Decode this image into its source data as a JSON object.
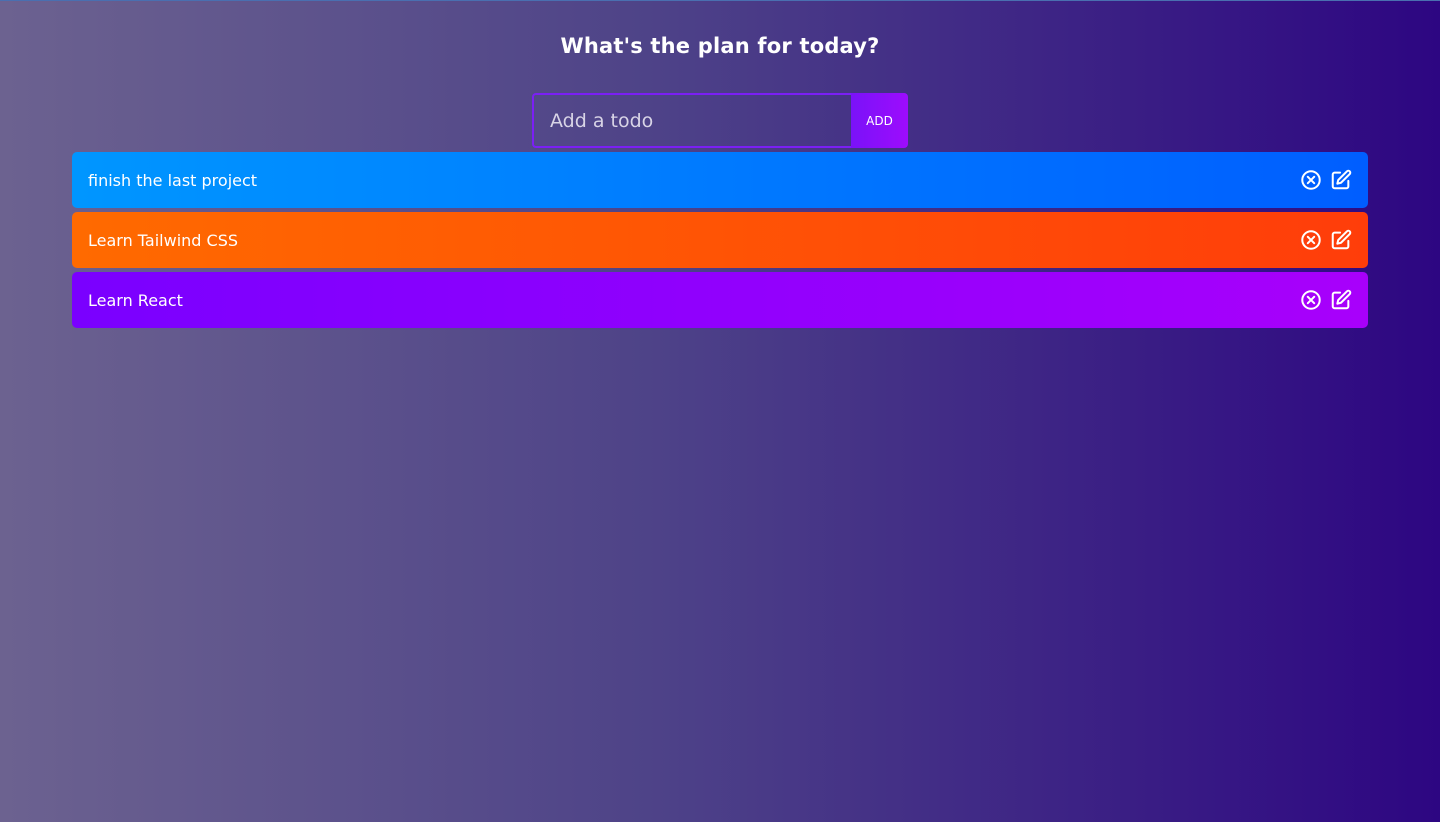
{
  "header": {
    "title": "What's the plan for today?"
  },
  "form": {
    "placeholder": "Add a todo",
    "value": "",
    "add_label": "ADD"
  },
  "todos": [
    {
      "text": "finish the last project",
      "gradient": [
        "#0096ff",
        "#005eff"
      ]
    },
    {
      "text": "Learn Tailwind CSS",
      "gradient": [
        "#ff6a00",
        "#ff3d0a"
      ]
    },
    {
      "text": "Learn React",
      "gradient": [
        "#7a00ff",
        "#a800fb"
      ]
    }
  ],
  "icons": {
    "delete": "close-circle-icon",
    "edit": "edit-icon"
  },
  "colors": {
    "input_border": "#7b1ff5",
    "add_button": "#8a10fa"
  }
}
